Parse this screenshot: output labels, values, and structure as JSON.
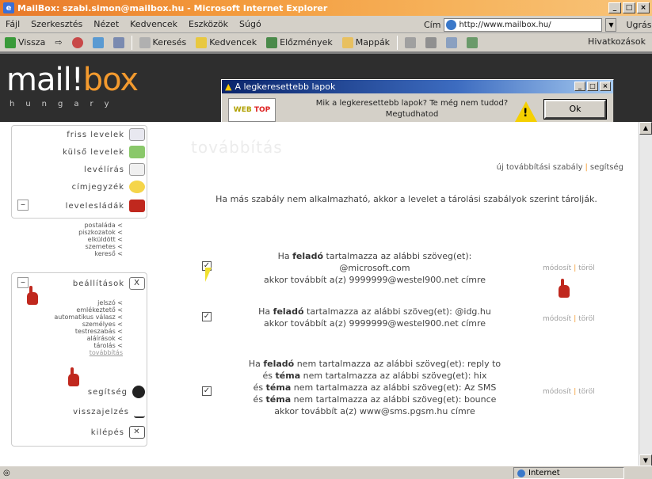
{
  "window": {
    "title": "MailBox: szabi.simon@mailbox.hu - Microsoft Internet Explorer",
    "controls": [
      "_",
      "□",
      "×"
    ]
  },
  "menu": {
    "items": [
      "Fájl",
      "Szerkesztés",
      "Nézet",
      "Kedvencek",
      "Eszközök",
      "Súgó"
    ],
    "address_label": "Cím",
    "address_value": "http://www.mailbox.hu/",
    "go_label": "Ugrás"
  },
  "toolbar": {
    "back": "Vissza",
    "search": "Keresés",
    "favorites": "Kedvencek",
    "media": "Előzmények",
    "history": "Mappák",
    "links": "Hivatkozások"
  },
  "brand": {
    "name_a": "mail!",
    "name_b": "box",
    "sub": "hungary"
  },
  "popup": {
    "title": "A legkeresettebb lapok",
    "badge_a": "WEB",
    "badge_b": "TOP",
    "text_line1": "Mik a legkeresettebb lapok? Te még nem tudod?",
    "text_line2": "Megtudhatod",
    "ok_label": "Ok"
  },
  "sidebar": {
    "items": [
      {
        "label": "friss levelek"
      },
      {
        "label": "külső levelek"
      },
      {
        "label": "levélírás"
      },
      {
        "label": "címjegyzék"
      },
      {
        "label": "levelesládák"
      }
    ],
    "folders": [
      "postaláda",
      "piszkozatok",
      "elküldött",
      "szemetes",
      "kereső"
    ],
    "settings_label": "beállítások",
    "settings_items": [
      "jelszó",
      "emlékeztető",
      "automatikus válasz",
      "személyes",
      "testreszabás",
      "aláírások",
      "tárolás",
      "továbbítás"
    ],
    "bottom": [
      {
        "label": "segítség"
      },
      {
        "label": "visszajelzés"
      },
      {
        "label": "kilépés"
      }
    ]
  },
  "main": {
    "page_title": "továbbítás",
    "link_new_rule": "új továbbítási szabály",
    "link_help": "segítség",
    "info": "Ha más szabály nem alkalmazható, akkor a levelet a tárolási szabályok szerint tárolják.",
    "rules": [
      {
        "prefix": "Ha ",
        "bold1": "feladó",
        "line1": " tartalmazza az alábbi szöveg(et):",
        "line2": "@microsoft.com",
        "line3": "akkor továbbít a(z) 9999999@westel900.net címre",
        "action_edit": "módosít",
        "action_delete": "töröl"
      },
      {
        "prefix": "Ha ",
        "bold1": "feladó",
        "line1": " tartalmazza az alábbi szöveg(et): @idg.hu",
        "line2": "akkor továbbít a(z) 9999999@westel900.net címre",
        "action_edit": "módosít",
        "action_delete": "töröl"
      },
      {
        "l1a": "Ha ",
        "l1b": "feladó",
        "l1c": " nem tartalmazza az alábbi szöveg(et): reply to",
        "l2a": "és ",
        "l2b": "téma",
        "l2c": " nem tartalmazza az alábbi szöveg(et): hix",
        "l3a": "és ",
        "l3b": "téma",
        "l3c": " nem tartalmazza az alábbi szöveg(et): Az SMS",
        "l4a": "és ",
        "l4b": "téma",
        "l4c": " nem tartalmazza az alábbi szöveg(et): bounce",
        "l5": "akkor továbbít a(z)   www@sms.pgsm.hu címre",
        "action_edit": "módosít",
        "action_delete": "töröl"
      }
    ]
  },
  "status": {
    "zone": "Internet"
  }
}
